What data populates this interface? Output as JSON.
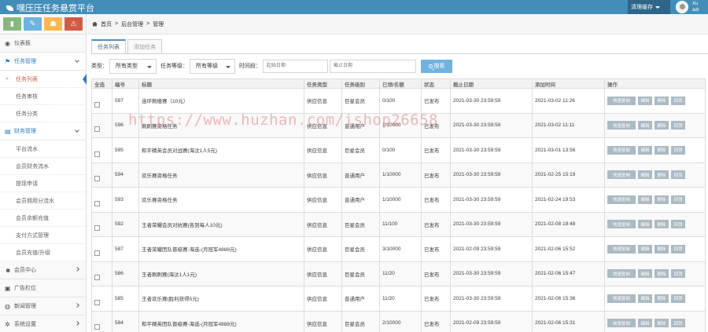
{
  "header": {
    "title": "嘿压压任务悬赏平台",
    "user_menu_label": "清理缓存",
    "user_info_line1": "Xu",
    "user_info_line2": "adr"
  },
  "shortcuts": [
    {
      "icon": "signal-icon",
      "glyph": "▮"
    },
    {
      "icon": "pencil-icon",
      "glyph": "✎"
    },
    {
      "icon": "users-icon",
      "glyph": "☗"
    },
    {
      "icon": "bell-icon",
      "glyph": "⚠"
    }
  ],
  "sidebar": {
    "dashboard": "仪表板",
    "task_mgmt": "任务管理",
    "task_items": [
      "任务列表",
      "任务审核",
      "任务分类"
    ],
    "finance_mgmt": "财务管理",
    "finance_items": [
      "平台流水",
      "会员财务流水",
      "提现申请",
      "会员佣用分流水",
      "会员余额充值",
      "支付方式管理",
      "会员充值/升级"
    ],
    "member_center": "会员中心",
    "ad_slots": "广告栏位",
    "news_mgmt": "新闻管理",
    "system_settings": "系统设置"
  },
  "breadcrumb": {
    "home": "首页",
    "sep": ">",
    "level1": "后台管理",
    "level2": "管理"
  },
  "tabs": [
    {
      "label": "任务列表",
      "active": true
    },
    {
      "label": "添加任务",
      "active": false
    }
  ],
  "filters": {
    "category_label": "类型：",
    "category_value": "所有类型",
    "level_label": "任务等级：",
    "level_value": "所有等级",
    "time_label": "时间段：",
    "start_placeholder": "起始日期",
    "end_placeholder": "截止日期",
    "search_label": "搜索"
  },
  "table": {
    "headers": [
      "全选",
      "编号",
      "标题",
      "任务类型",
      "任务级别",
      "已领/名额",
      "状态",
      "截止日期",
      "添加时间",
      "操作"
    ],
    "action_labels": [
      "快速复制",
      "编辑",
      "删除",
      "回顶"
    ],
    "rows": [
      {
        "id": "597",
        "title": "连环刷楼赛（10元）",
        "type": "供应信息",
        "level": "巨星会员",
        "quota": "0/100",
        "status": "已发布",
        "deadline": "2021-03-30 23:59:59",
        "added": "2021-03-02 11:26"
      },
      {
        "id": "596",
        "title": "刷刷赛资格任务",
        "type": "供应信息",
        "level": "普通用户",
        "quota": "1/10000",
        "status": "已发布",
        "deadline": "2021-03-30 23:59:59",
        "added": "2021-03-02 11:11"
      },
      {
        "id": "595",
        "title": "和平精英会员对战赛(海汰1人5元)",
        "type": "供应信息",
        "level": "巨星会员",
        "quota": "0/100",
        "status": "已发布",
        "deadline": "2021-03-30 23:59:59",
        "added": "2021-03-01 13:56"
      },
      {
        "id": "594",
        "title": "欢乐赛资格任务",
        "type": "供应信息",
        "level": "普通用户",
        "quota": "1/10000",
        "status": "已发布",
        "deadline": "2021-03-30 23:59:59",
        "added": "2021-02-25 15:19"
      },
      {
        "id": "593",
        "title": "欢乐赛资格任务",
        "type": "供应信息",
        "level": "普通用户",
        "quota": "1/10000",
        "status": "已发布",
        "deadline": "2021-03-30 23:59:59",
        "added": "2021-02-24 19:53"
      },
      {
        "id": "592",
        "title": "王者荣耀会员对抗赛(各到每人10元)",
        "type": "供应信息",
        "level": "巨星会员",
        "quota": "11/100",
        "status": "已发布",
        "deadline": "2021-03-30 23:59:59",
        "added": "2021-02-08 19:48"
      },
      {
        "id": "587",
        "title": "王者荣耀团队晋级赛-海选-(月冠军4888元)",
        "type": "供应信息",
        "level": "巨星会员",
        "quota": "3/10000",
        "status": "已发布",
        "deadline": "2021-02-09 23:59:59",
        "added": "2021-02-06 15:52"
      },
      {
        "id": "586",
        "title": "王者刷刷赛(海汰1人1元)",
        "type": "供应信息",
        "level": "巨星会员",
        "quota": "11/20",
        "status": "已发布",
        "deadline": "2021-03-30 23:59:59",
        "added": "2021-02-06 15:47"
      },
      {
        "id": "585",
        "title": "王者欢乐赛(胜利获得5元)",
        "type": "供应信息",
        "level": "普通用户",
        "quota": "11/20",
        "status": "已发布",
        "deadline": "2021-03-30 23:59:59",
        "added": "2021-02-06 15:36"
      },
      {
        "id": "584",
        "title": "和平精英团队晋级赛-海选-(月冠军4888元)",
        "type": "供应信息",
        "level": "巨星会员",
        "quota": "2/10000",
        "status": "已发布",
        "deadline": "2021-02-09 23:59:59",
        "added": "2021-02-06 15:31"
      }
    ]
  },
  "watermark": "https://www.huzhan.com/ishop26658"
}
